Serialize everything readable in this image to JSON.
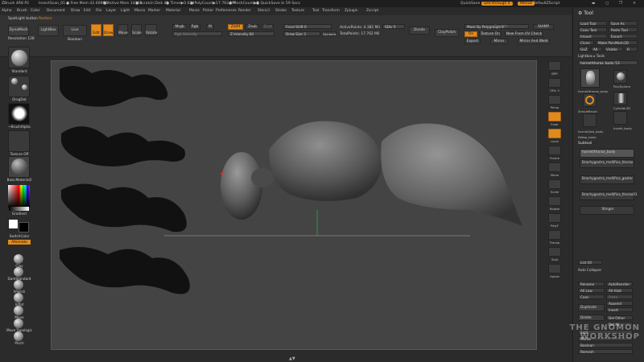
{
  "titlebar": {
    "app": "ZBrush 4R8 P2",
    "doc": "InsectScan_01",
    "free_mem": "● Free Mem 42.609GB",
    "active_mem": "● Active Mem 14164",
    "scratch": "● Scratch Disk 41",
    "timer": "● Timer▶0.024",
    "polycount": "● PolyCount▶17.762 MP",
    "meshcount": "● MeshCount▶5",
    "quicksave": "● QuickSave In 59 Secs",
    "quicksave_btn": "QuickSave",
    "see_through": "See-through 0",
    "menus": "Menus",
    "default_script": "DefaultZScript"
  },
  "menubar": [
    "Alpha",
    "Brush",
    "Color",
    "Document",
    "Draw",
    "Edit",
    "File",
    "Layer",
    "Light",
    "Macro",
    "Marker",
    "Material",
    "Movie",
    "Picker",
    "Preferences",
    "Render",
    "Stencil",
    "Stroke",
    "Texture",
    "Tool",
    "Transform",
    "Zplugin",
    "Zscript"
  ],
  "toolbar": {
    "spotlight": "SpotLight button",
    "restore": "Restore",
    "dynamesh": "DynaMesh",
    "lightbox": "LightBox",
    "live_boolean": "Live Boolean",
    "resolution": "Resolution 128",
    "edit": "Edit",
    "draw": "Draw",
    "move": "Move",
    "scale": "Scale",
    "rotate": "Rotate",
    "mrgb": "Mrgb",
    "rgb": "Rgb",
    "m": "M",
    "zadd": "Zadd",
    "zsub": "Zsub",
    "zcut": "Zcut",
    "rgb_intensity": "Rgb Intensity",
    "z_intensity": "Z Intensity 60",
    "focal_shift": "Focal Shift 0",
    "draw_size": "Draw Size 3",
    "dynamic": "Dynamic",
    "active_points": "ActivePoints: 4.382 Mil",
    "total_points": "TotalPoints: 17.762 Mil",
    "sdiv": "SDiv 5",
    "divide": "Divide",
    "claypolish": "ClayPolish",
    "mask_by_polygroups": "Mask By Polygroups 0",
    "smooth": "Smooth",
    "on": "On",
    "texture_on": "Texture On",
    "new_from_uv_check": "New From UV Check",
    "export": "Export",
    "mirror": "Mirror",
    "mirror_and_weld": "Mirror And Weld",
    "stamp": "StAMP"
  },
  "left_shelf": {
    "brush": "Standard",
    "stroke": "DragDot",
    "alpha": "~BrushAlpha",
    "texture": "Texture Off",
    "material": "BasicMaterial2",
    "gradient": "Gradient",
    "switch_color": "SwitchColor",
    "alternate": "Alternate",
    "brushes": [
      "Clay",
      "DamStandard",
      "hPolish",
      "Inflat",
      "Move",
      "Move Topologic",
      "Pinch"
    ]
  },
  "right_shelf": [
    "BPR",
    "SPix 3",
    "Persp",
    "Floor",
    "Local",
    "Frame",
    "Move",
    "Scale",
    "Rotate",
    "PolyF",
    "Transp",
    "Solo",
    "Xpose"
  ],
  "tool_panel": {
    "title": "Tool",
    "load_tool": "Load Tool",
    "save_as": "Save As",
    "copy_tool": "Copy Tool",
    "paste_tool": "Paste Tool",
    "import": "Import",
    "export": "Export",
    "clone": "Clone",
    "make_polymesh": "Make PolyMesh3D",
    "goz": "GoZ",
    "all": "All",
    "visible": "Visible",
    "r": "R",
    "lightbox_tools": "Lightbox ▸ Tools",
    "current_tool": "hornet/thorax_body. 53",
    "tools": [
      "hornet/thorax_body",
      "PolySphere",
      "SimpleBrush",
      "Cylinder3D",
      "hornet/low_body",
      "Insekt_body",
      "IWasp_body"
    ],
    "subtool_header": "Subtool",
    "subtools": [
      "hornet/thorax_body",
      "Brachygastra_mellifica_thorax",
      "Brachygastra_mellifica_gaster",
      "Brachygastra_mellifica_thorax01",
      "Stinger"
    ],
    "list_all": "List All",
    "auto_collapse": "Auto Collapse",
    "rename": "Rename",
    "autoreorder": "AutoReorder",
    "all_low": "All Low",
    "all_high": "All High",
    "copy": "Copy",
    "paste": "Paste",
    "append": "Append",
    "duplicate": "Duplicate",
    "insert": "Insert",
    "delete": "Delete",
    "del_other": "Del Other",
    "del_all": "Del All",
    "split": "Split",
    "merge": "Merge",
    "boolean": "Boolean",
    "remesh": "Remesh"
  },
  "watermark": "THE GNOMON WORKSHOP"
}
